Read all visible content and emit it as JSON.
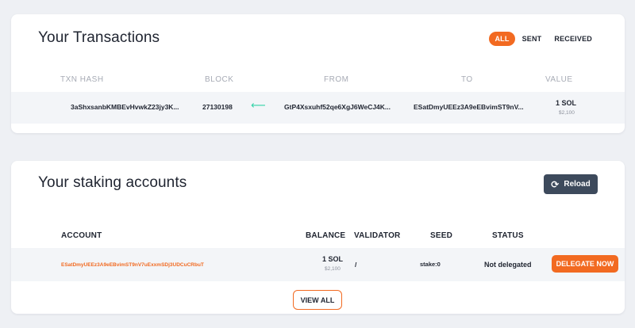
{
  "colors": {
    "accent": "#f26a21",
    "arrow": "#34d3a8",
    "reload_bg": "#3d4a5c"
  },
  "transactions": {
    "title": "Your Transactions",
    "filters": [
      "ALL",
      "SENT",
      "RECEIVED"
    ],
    "active_filter": "ALL",
    "columns": [
      "TXN HASH",
      "BLOCK",
      "FROM",
      "TO",
      "VALUE"
    ],
    "rows": [
      {
        "hash": "3aShxsanbKMBEvHvwkZ23jy3K...",
        "block": "27130198",
        "direction_icon": "arrow-left-icon",
        "from": "GtP4Xsxuhf52qe6XgJ6WeCJ4K...",
        "to": "ESatDmyUEEz3A9eEBvimST9nV...",
        "value": "1 SOL",
        "value_usd": "$2,100"
      }
    ]
  },
  "staking": {
    "title": "Your staking accounts",
    "reload_label": "Reload",
    "columns": [
      "ACCOUNT",
      "BALANCE",
      "VALIDATOR",
      "SEED",
      "STATUS"
    ],
    "rows": [
      {
        "account": "ESatDmyUEEz3A9eEBvimST9nV7uExxmSDj3UDCuCRbuT",
        "balance": "1 SOL",
        "balance_usd": "$2,100",
        "validator": "/",
        "seed": "stake:0",
        "status": "Not delegated",
        "action": "DELEGATE NOW"
      }
    ],
    "view_all_label": "VIEW ALL"
  }
}
